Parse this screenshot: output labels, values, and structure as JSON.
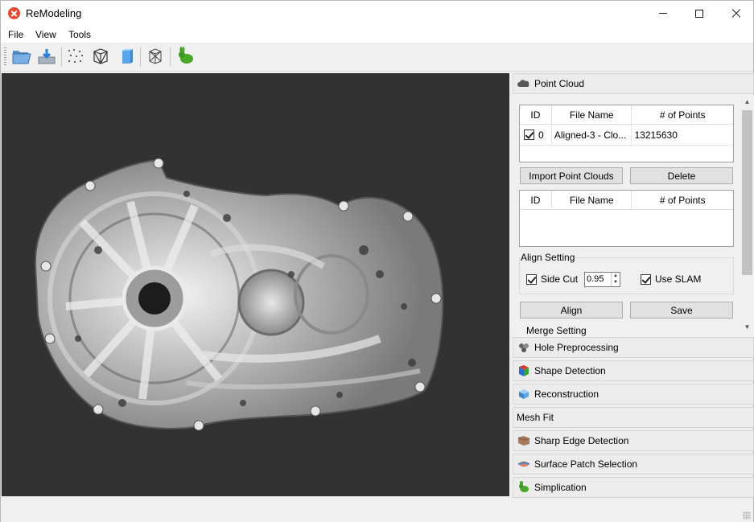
{
  "app": {
    "title": "ReModeling"
  },
  "menu": [
    "File",
    "View",
    "Tools"
  ],
  "toolbar": {
    "buttons": [
      "open-folder-icon",
      "import-icon",
      "point-cloud-icon",
      "mesh-cube-icon",
      "box-icon",
      "wireframe-icon",
      "bunny-icon"
    ]
  },
  "panel": {
    "point_cloud": {
      "title": "Point Cloud",
      "table1": {
        "headers": [
          "ID",
          "File Name",
          "# of Points"
        ],
        "rows": [
          {
            "checked": true,
            "id": "0",
            "file": "Aligned-3 - Clo...",
            "points": "13215630"
          }
        ]
      },
      "import_label": "Import Point Clouds",
      "delete_label": "Delete",
      "table2": {
        "headers": [
          "ID",
          "File Name",
          "# of Points"
        ]
      },
      "align_setting": {
        "title": "Align Setting",
        "side_cut_label": "Side Cut",
        "side_cut_checked": true,
        "side_cut_value": "0.95",
        "use_slam_label": "Use SLAM",
        "use_slam_checked": true
      },
      "align_label": "Align",
      "save_label": "Save",
      "merge_setting": "Merge Setting"
    },
    "sections": [
      {
        "label": "Hole Preprocessing",
        "icon": "hole-icon"
      },
      {
        "label": "Shape Detection",
        "icon": "shape-icon"
      },
      {
        "label": "Reconstruction",
        "icon": "cube-icon"
      },
      {
        "label": "Mesh Fit",
        "icon": ""
      },
      {
        "label": "Sharp Edge Detection",
        "icon": "edge-icon"
      },
      {
        "label": "Surface Patch Selection",
        "icon": "surface-icon"
      },
      {
        "label": "Simplication",
        "icon": "bunny-icon"
      }
    ]
  },
  "colors": {
    "viewport_bg": "#323232",
    "panel_bg": "#f0f0f0",
    "accent_green": "#3aa020"
  }
}
